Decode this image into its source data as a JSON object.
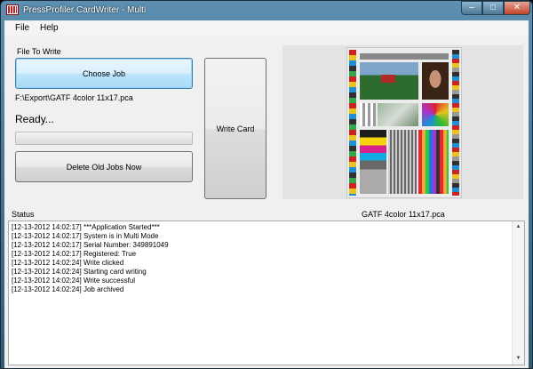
{
  "window": {
    "title": "PressProfiler CardWriter - Multi",
    "min_glyph": "–",
    "max_glyph": "□",
    "close_glyph": "✕"
  },
  "menu": {
    "items": [
      "File",
      "Help"
    ]
  },
  "main": {
    "file_to_write_label": "File To Write",
    "choose_job_label": "Choose Job",
    "file_path": "F:\\Export\\GATF 4color 11x17.pca",
    "status_text": "Ready...",
    "progress": 0,
    "delete_label": "Delete Old Jobs Now",
    "write_card_label": "Write Card"
  },
  "preview": {
    "caption": "GATF 4color 11x17.pca"
  },
  "status": {
    "label": "Status",
    "lines": [
      "[12-13-2012 14:02:17] ***Application Started***",
      "[12-13-2012 14:02:17] System is in Multi Mode",
      "[12-13-2012 14:02:17] Serial Number: 349891049",
      "[12-13-2012 14:02:17] Registered: True",
      "[12-13-2012 14:02:24] Write clicked",
      "[12-13-2012 14:02:24] Starting card writing",
      "[12-13-2012 14:02:24] Write successful",
      "[12-13-2012 14:02:24] Job archived"
    ]
  }
}
